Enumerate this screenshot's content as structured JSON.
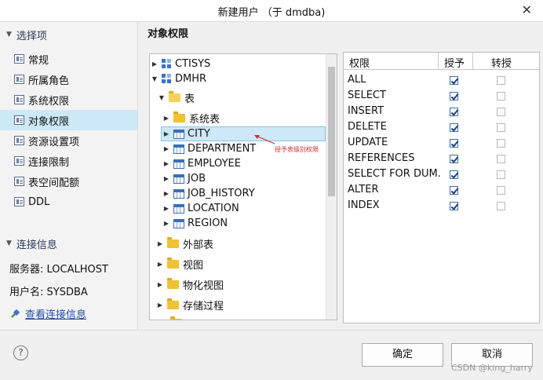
{
  "window": {
    "title": "新建用户 （于 dmdba)",
    "close_glyph": "✕"
  },
  "sidebar": {
    "section_title": "选择项",
    "items": [
      {
        "label": "常规"
      },
      {
        "label": "所属角色"
      },
      {
        "label": "系统权限"
      },
      {
        "label": "对象权限"
      },
      {
        "label": "资源设置项"
      },
      {
        "label": "连接限制"
      },
      {
        "label": "表空间配额"
      },
      {
        "label": "DDL"
      }
    ],
    "selected_index": 3
  },
  "connection": {
    "section_title": "连接信息",
    "server": "服务器: LOCALHOST",
    "username": "用户名: SYSDBA",
    "view_link": "查看连接信息"
  },
  "main": {
    "title": "对象权限"
  },
  "tree": {
    "nodes": [
      {
        "label": "CTISYS",
        "icon": "database-icon",
        "expanded": false
      },
      {
        "label": "DMHR",
        "icon": "database-icon",
        "expanded": true
      },
      {
        "label": "表",
        "icon": "folder-icon",
        "expanded": true
      },
      {
        "label": "系统表",
        "icon": "folder-icon",
        "expanded": false
      },
      {
        "label": "CITY",
        "icon": "table-icon",
        "selected": true
      },
      {
        "label": "DEPARTMENT",
        "icon": "table-icon"
      },
      {
        "label": "EMPLOYEE",
        "icon": "table-icon"
      },
      {
        "label": "JOB",
        "icon": "table-icon"
      },
      {
        "label": "JOB_HISTORY",
        "icon": "table-icon"
      },
      {
        "label": "LOCATION",
        "icon": "table-icon"
      },
      {
        "label": "REGION",
        "icon": "table-icon"
      },
      {
        "label": "外部表",
        "icon": "folder-icon"
      },
      {
        "label": "视图",
        "icon": "folder-icon"
      },
      {
        "label": "物化视图",
        "icon": "folder-icon"
      },
      {
        "label": "存储过程",
        "icon": "folder-icon"
      }
    ],
    "annotation": "授予表级别权限"
  },
  "permissions": {
    "headers": {
      "name": "权限",
      "grant": "授予",
      "transfer": "转授"
    },
    "rows": [
      {
        "name": "ALL",
        "grant": true,
        "transfer": false
      },
      {
        "name": "SELECT",
        "grant": true,
        "transfer": false
      },
      {
        "name": "INSERT",
        "grant": true,
        "transfer": false
      },
      {
        "name": "DELETE",
        "grant": true,
        "transfer": false
      },
      {
        "name": "UPDATE",
        "grant": true,
        "transfer": false
      },
      {
        "name": "REFERENCES",
        "grant": true,
        "transfer": false
      },
      {
        "name": "SELECT FOR DUM.",
        "grant": true,
        "transfer": false
      },
      {
        "name": "ALTER",
        "grant": true,
        "transfer": false
      },
      {
        "name": "INDEX",
        "grant": true,
        "transfer": false
      }
    ]
  },
  "footer": {
    "help_glyph": "?",
    "ok_label": "确定",
    "cancel_label": "取消"
  },
  "watermark": "CSDN @king_harry",
  "colors": {
    "selection": "#cde8f6",
    "link": "#1f4aa8",
    "annotation": "#d03030"
  }
}
